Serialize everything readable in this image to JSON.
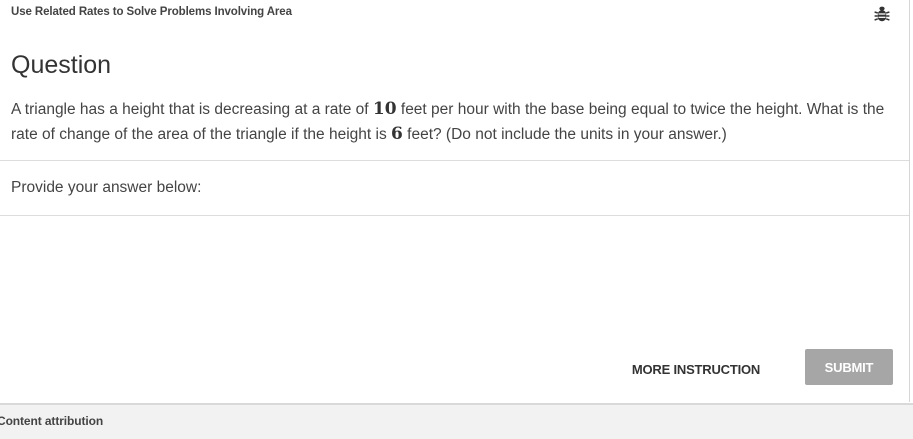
{
  "header": {
    "topic_title": "Use Related Rates to Solve Problems Involving Area",
    "report_icon": "bug-icon"
  },
  "question": {
    "heading": "Question",
    "text_part1": "A triangle has a height that is decreasing at a rate of ",
    "rate_value": "10",
    "text_part2": " feet per hour with the base being equal to twice the height. What is the rate of change of the area of the triangle if the height is ",
    "height_value": "6",
    "text_part3": " feet? (Do not include the units in your answer.)"
  },
  "answer": {
    "prompt": "Provide your answer below:",
    "value": ""
  },
  "actions": {
    "more_instruction_label": "MORE INSTRUCTION",
    "submit_label": "SUBMIT"
  },
  "footer": {
    "attribution_label": "Content attribution"
  },
  "colors": {
    "submit_disabled_bg": "#a6a6a6",
    "footer_bg": "#f2f2f2"
  }
}
